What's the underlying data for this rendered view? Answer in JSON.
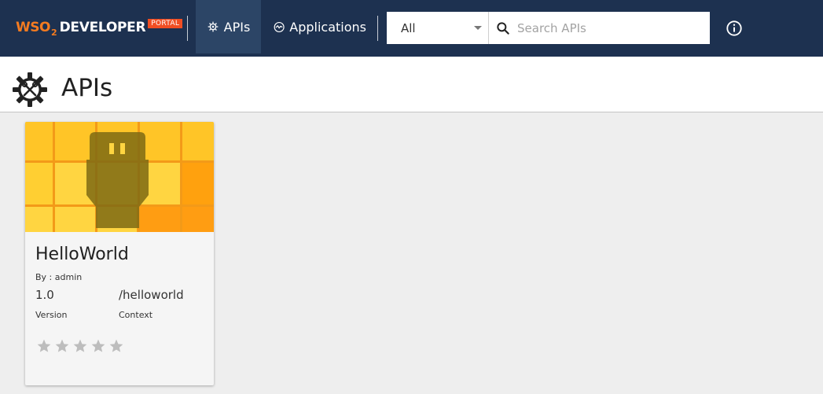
{
  "brand": {
    "wso": "WSO",
    "two": "2",
    "developer": "DEVELOPER",
    "portal": "PORTAL",
    "accent_color": "#f47b20",
    "portal_badge_color": "#f04e23",
    "topbar_color": "#1d3150"
  },
  "nav": {
    "apis": {
      "label": "APIs",
      "icon": "gear-icon",
      "active": true
    },
    "applications": {
      "label": "Applications",
      "icon": "activity-icon"
    }
  },
  "search": {
    "filter_value": "All",
    "placeholder": "Search APIs",
    "search_icon": "search-icon"
  },
  "info_icon": "info-icon",
  "header": {
    "title": "APIs",
    "icon": "gear-wrench-icon"
  },
  "cards": [
    {
      "name": "HelloWorld",
      "by": "By : admin",
      "version": "1.0",
      "version_label": "Version",
      "context": "/helloworld",
      "context_label": "Context",
      "rating": 0,
      "max_rating": 5,
      "thumbnail_icon": "connector-plug-icon"
    }
  ]
}
